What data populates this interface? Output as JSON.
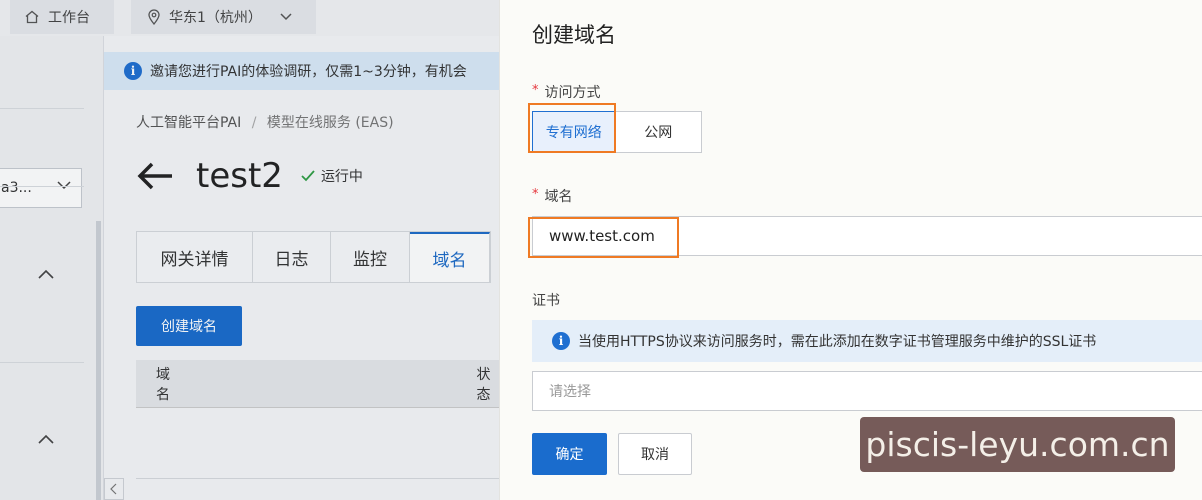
{
  "topbar": {
    "workbench_label": "工作台",
    "region_label": "华东1（杭州）"
  },
  "leftnav": {
    "select_value": "a3...",
    "collapse_icon": "chevron-up-icon"
  },
  "banner": {
    "text": "邀请您进行PAI的体验调研，仅需1~3分钟，有机会"
  },
  "breadcrumb": {
    "root": "人工智能平台PAI",
    "separator": "/",
    "current": "模型在线服务 (EAS)"
  },
  "service": {
    "name": "test2",
    "status": "运行中",
    "status_color": "#2f9e44"
  },
  "tabs": [
    {
      "label": "网关详情"
    },
    {
      "label": "日志"
    },
    {
      "label": "监控"
    },
    {
      "label": "域名"
    }
  ],
  "list": {
    "create_button": "创建域名",
    "columns": [
      "域名",
      "状态"
    ]
  },
  "drawer": {
    "title": "创建域名",
    "access": {
      "label": "访问方式",
      "options": [
        {
          "label": "专有网络",
          "selected": true
        },
        {
          "label": "公网",
          "selected": false
        }
      ]
    },
    "domain": {
      "label": "域名",
      "value": "www.test.com"
    },
    "cert": {
      "label": "证书",
      "notice": "当使用HTTPS协议来访问服务时，需在此添加在数字证书管理服务中维护的SSL证书",
      "placeholder": "请选择"
    },
    "confirm_label": "确定",
    "cancel_label": "取消",
    "required_mark": "*"
  },
  "watermark": {
    "text": "piscis-leyu.com.cn"
  },
  "colors": {
    "primary": "#1a6ccd",
    "highlight": "#ef7a24",
    "required": "#e5363d"
  }
}
